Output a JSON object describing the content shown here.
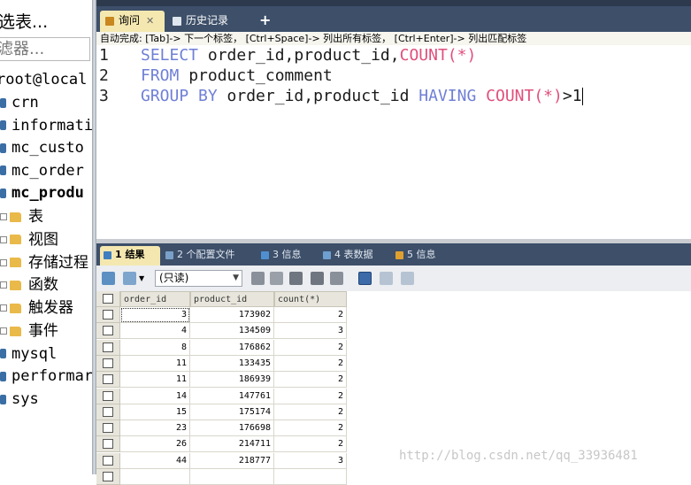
{
  "sidebar": {
    "title": "选表...",
    "filter_placeholder": "滤器...",
    "host": "root@local",
    "databases": [
      {
        "name": "crn",
        "bold": false
      },
      {
        "name": "informati",
        "bold": false
      },
      {
        "name": "mc_custo",
        "bold": false
      },
      {
        "name": "mc_order",
        "bold": false
      },
      {
        "name": "mc_produ",
        "bold": true
      }
    ],
    "folders": [
      "表",
      "视图",
      "存储过程",
      "函数",
      "触发器",
      "事件"
    ],
    "more_databases": [
      "mysql",
      "performar",
      "sys"
    ]
  },
  "tabs": [
    {
      "label": "询问",
      "active": true,
      "closable": true
    },
    {
      "label": "历史记录",
      "active": false
    }
  ],
  "new_tab_label": "+",
  "hint": "自动完成:  [Tab]-> 下一个标签，  [Ctrl+Space]-> 列出所有标签，  [Ctrl+Enter]-> 列出匹配标签",
  "editor": {
    "lines": [
      {
        "num": "1",
        "tokens": [
          {
            "t": "SELECT ",
            "c": "kw"
          },
          {
            "t": "order_id,product_id,",
            "c": "id"
          },
          {
            "t": "COUNT",
            "c": "fn"
          },
          {
            "t": "(*)",
            "c": "fn"
          }
        ]
      },
      {
        "num": "2",
        "tokens": [
          {
            "t": "FROM ",
            "c": "kw"
          },
          {
            "t": "product_comment",
            "c": "id"
          }
        ]
      },
      {
        "num": "3",
        "tokens": [
          {
            "t": "GROUP BY ",
            "c": "kw"
          },
          {
            "t": "order_id,product_id ",
            "c": "id"
          },
          {
            "t": "HAVING ",
            "c": "kw"
          },
          {
            "t": "COUNT",
            "c": "fn"
          },
          {
            "t": "(*)",
            "c": "fn"
          },
          {
            "t": ">1",
            "c": "id"
          }
        ]
      }
    ]
  },
  "result_tabs": [
    {
      "label": "1 结果",
      "active": true,
      "color": "#3f7fbf"
    },
    {
      "label": "2 个配置文件",
      "active": false,
      "color": "#7aa0c8"
    },
    {
      "label": "3 信息",
      "active": false,
      "color": "#4f8fd0"
    },
    {
      "label": "4 表数据",
      "active": false,
      "color": "#6f9fd0"
    },
    {
      "label": "5 信息",
      "active": false,
      "color": "#e0a030"
    }
  ],
  "toolbar": {
    "mode_value": "(只读)"
  },
  "grid": {
    "columns": [
      "order_id",
      "product_id",
      "count(*)"
    ],
    "rows": [
      [
        "3",
        "173902",
        "2"
      ],
      [
        "4",
        "134509",
        "3"
      ],
      [
        "8",
        "176862",
        "2"
      ],
      [
        "11",
        "133435",
        "2"
      ],
      [
        "11",
        "186939",
        "2"
      ],
      [
        "14",
        "147761",
        "2"
      ],
      [
        "15",
        "175174",
        "2"
      ],
      [
        "23",
        "176698",
        "2"
      ],
      [
        "26",
        "214711",
        "2"
      ],
      [
        "44",
        "218777",
        "3"
      ],
      [
        "",
        "",
        ""
      ]
    ]
  },
  "watermark": "http://blog.csdn.net/qq_33936481"
}
